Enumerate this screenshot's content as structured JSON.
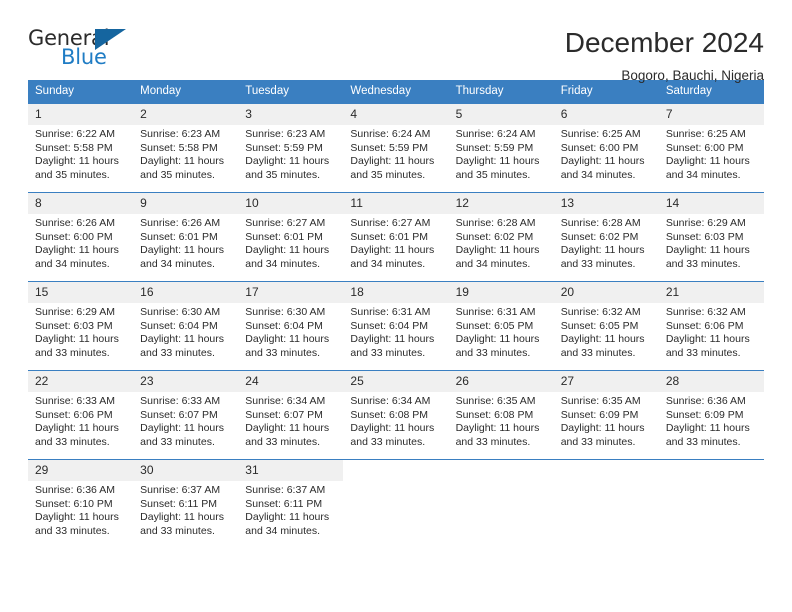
{
  "logo": {
    "primary_text": "General",
    "secondary_text": "Blue",
    "primary_color": "#2b2b2b",
    "secondary_color": "#1f7cc4",
    "triangle_color": "#15659f"
  },
  "header": {
    "title": "December 2024",
    "location": "Bogoro, Bauchi, Nigeria"
  },
  "calendar": {
    "header_bg": "#3a7fc1",
    "day_band_bg": "#f0f0f0",
    "weekdays": [
      "Sunday",
      "Monday",
      "Tuesday",
      "Wednesday",
      "Thursday",
      "Friday",
      "Saturday"
    ],
    "weeks": [
      [
        {
          "day": "1",
          "sunrise": "Sunrise: 6:22 AM",
          "sunset": "Sunset: 5:58 PM",
          "daylight_line1": "Daylight: 11 hours",
          "daylight_line2": "and 35 minutes."
        },
        {
          "day": "2",
          "sunrise": "Sunrise: 6:23 AM",
          "sunset": "Sunset: 5:58 PM",
          "daylight_line1": "Daylight: 11 hours",
          "daylight_line2": "and 35 minutes."
        },
        {
          "day": "3",
          "sunrise": "Sunrise: 6:23 AM",
          "sunset": "Sunset: 5:59 PM",
          "daylight_line1": "Daylight: 11 hours",
          "daylight_line2": "and 35 minutes."
        },
        {
          "day": "4",
          "sunrise": "Sunrise: 6:24 AM",
          "sunset": "Sunset: 5:59 PM",
          "daylight_line1": "Daylight: 11 hours",
          "daylight_line2": "and 35 minutes."
        },
        {
          "day": "5",
          "sunrise": "Sunrise: 6:24 AM",
          "sunset": "Sunset: 5:59 PM",
          "daylight_line1": "Daylight: 11 hours",
          "daylight_line2": "and 35 minutes."
        },
        {
          "day": "6",
          "sunrise": "Sunrise: 6:25 AM",
          "sunset": "Sunset: 6:00 PM",
          "daylight_line1": "Daylight: 11 hours",
          "daylight_line2": "and 34 minutes."
        },
        {
          "day": "7",
          "sunrise": "Sunrise: 6:25 AM",
          "sunset": "Sunset: 6:00 PM",
          "daylight_line1": "Daylight: 11 hours",
          "daylight_line2": "and 34 minutes."
        }
      ],
      [
        {
          "day": "8",
          "sunrise": "Sunrise: 6:26 AM",
          "sunset": "Sunset: 6:00 PM",
          "daylight_line1": "Daylight: 11 hours",
          "daylight_line2": "and 34 minutes."
        },
        {
          "day": "9",
          "sunrise": "Sunrise: 6:26 AM",
          "sunset": "Sunset: 6:01 PM",
          "daylight_line1": "Daylight: 11 hours",
          "daylight_line2": "and 34 minutes."
        },
        {
          "day": "10",
          "sunrise": "Sunrise: 6:27 AM",
          "sunset": "Sunset: 6:01 PM",
          "daylight_line1": "Daylight: 11 hours",
          "daylight_line2": "and 34 minutes."
        },
        {
          "day": "11",
          "sunrise": "Sunrise: 6:27 AM",
          "sunset": "Sunset: 6:01 PM",
          "daylight_line1": "Daylight: 11 hours",
          "daylight_line2": "and 34 minutes."
        },
        {
          "day": "12",
          "sunrise": "Sunrise: 6:28 AM",
          "sunset": "Sunset: 6:02 PM",
          "daylight_line1": "Daylight: 11 hours",
          "daylight_line2": "and 34 minutes."
        },
        {
          "day": "13",
          "sunrise": "Sunrise: 6:28 AM",
          "sunset": "Sunset: 6:02 PM",
          "daylight_line1": "Daylight: 11 hours",
          "daylight_line2": "and 33 minutes."
        },
        {
          "day": "14",
          "sunrise": "Sunrise: 6:29 AM",
          "sunset": "Sunset: 6:03 PM",
          "daylight_line1": "Daylight: 11 hours",
          "daylight_line2": "and 33 minutes."
        }
      ],
      [
        {
          "day": "15",
          "sunrise": "Sunrise: 6:29 AM",
          "sunset": "Sunset: 6:03 PM",
          "daylight_line1": "Daylight: 11 hours",
          "daylight_line2": "and 33 minutes."
        },
        {
          "day": "16",
          "sunrise": "Sunrise: 6:30 AM",
          "sunset": "Sunset: 6:04 PM",
          "daylight_line1": "Daylight: 11 hours",
          "daylight_line2": "and 33 minutes."
        },
        {
          "day": "17",
          "sunrise": "Sunrise: 6:30 AM",
          "sunset": "Sunset: 6:04 PM",
          "daylight_line1": "Daylight: 11 hours",
          "daylight_line2": "and 33 minutes."
        },
        {
          "day": "18",
          "sunrise": "Sunrise: 6:31 AM",
          "sunset": "Sunset: 6:04 PM",
          "daylight_line1": "Daylight: 11 hours",
          "daylight_line2": "and 33 minutes."
        },
        {
          "day": "19",
          "sunrise": "Sunrise: 6:31 AM",
          "sunset": "Sunset: 6:05 PM",
          "daylight_line1": "Daylight: 11 hours",
          "daylight_line2": "and 33 minutes."
        },
        {
          "day": "20",
          "sunrise": "Sunrise: 6:32 AM",
          "sunset": "Sunset: 6:05 PM",
          "daylight_line1": "Daylight: 11 hours",
          "daylight_line2": "and 33 minutes."
        },
        {
          "day": "21",
          "sunrise": "Sunrise: 6:32 AM",
          "sunset": "Sunset: 6:06 PM",
          "daylight_line1": "Daylight: 11 hours",
          "daylight_line2": "and 33 minutes."
        }
      ],
      [
        {
          "day": "22",
          "sunrise": "Sunrise: 6:33 AM",
          "sunset": "Sunset: 6:06 PM",
          "daylight_line1": "Daylight: 11 hours",
          "daylight_line2": "and 33 minutes."
        },
        {
          "day": "23",
          "sunrise": "Sunrise: 6:33 AM",
          "sunset": "Sunset: 6:07 PM",
          "daylight_line1": "Daylight: 11 hours",
          "daylight_line2": "and 33 minutes."
        },
        {
          "day": "24",
          "sunrise": "Sunrise: 6:34 AM",
          "sunset": "Sunset: 6:07 PM",
          "daylight_line1": "Daylight: 11 hours",
          "daylight_line2": "and 33 minutes."
        },
        {
          "day": "25",
          "sunrise": "Sunrise: 6:34 AM",
          "sunset": "Sunset: 6:08 PM",
          "daylight_line1": "Daylight: 11 hours",
          "daylight_line2": "and 33 minutes."
        },
        {
          "day": "26",
          "sunrise": "Sunrise: 6:35 AM",
          "sunset": "Sunset: 6:08 PM",
          "daylight_line1": "Daylight: 11 hours",
          "daylight_line2": "and 33 minutes."
        },
        {
          "day": "27",
          "sunrise": "Sunrise: 6:35 AM",
          "sunset": "Sunset: 6:09 PM",
          "daylight_line1": "Daylight: 11 hours",
          "daylight_line2": "and 33 minutes."
        },
        {
          "day": "28",
          "sunrise": "Sunrise: 6:36 AM",
          "sunset": "Sunset: 6:09 PM",
          "daylight_line1": "Daylight: 11 hours",
          "daylight_line2": "and 33 minutes."
        }
      ],
      [
        {
          "day": "29",
          "sunrise": "Sunrise: 6:36 AM",
          "sunset": "Sunset: 6:10 PM",
          "daylight_line1": "Daylight: 11 hours",
          "daylight_line2": "and 33 minutes."
        },
        {
          "day": "30",
          "sunrise": "Sunrise: 6:37 AM",
          "sunset": "Sunset: 6:11 PM",
          "daylight_line1": "Daylight: 11 hours",
          "daylight_line2": "and 33 minutes."
        },
        {
          "day": "31",
          "sunrise": "Sunrise: 6:37 AM",
          "sunset": "Sunset: 6:11 PM",
          "daylight_line1": "Daylight: 11 hours",
          "daylight_line2": "and 34 minutes."
        },
        {
          "day": "",
          "sunrise": "",
          "sunset": "",
          "daylight_line1": "",
          "daylight_line2": ""
        },
        {
          "day": "",
          "sunrise": "",
          "sunset": "",
          "daylight_line1": "",
          "daylight_line2": ""
        },
        {
          "day": "",
          "sunrise": "",
          "sunset": "",
          "daylight_line1": "",
          "daylight_line2": ""
        },
        {
          "day": "",
          "sunrise": "",
          "sunset": "",
          "daylight_line1": "",
          "daylight_line2": ""
        }
      ]
    ]
  }
}
